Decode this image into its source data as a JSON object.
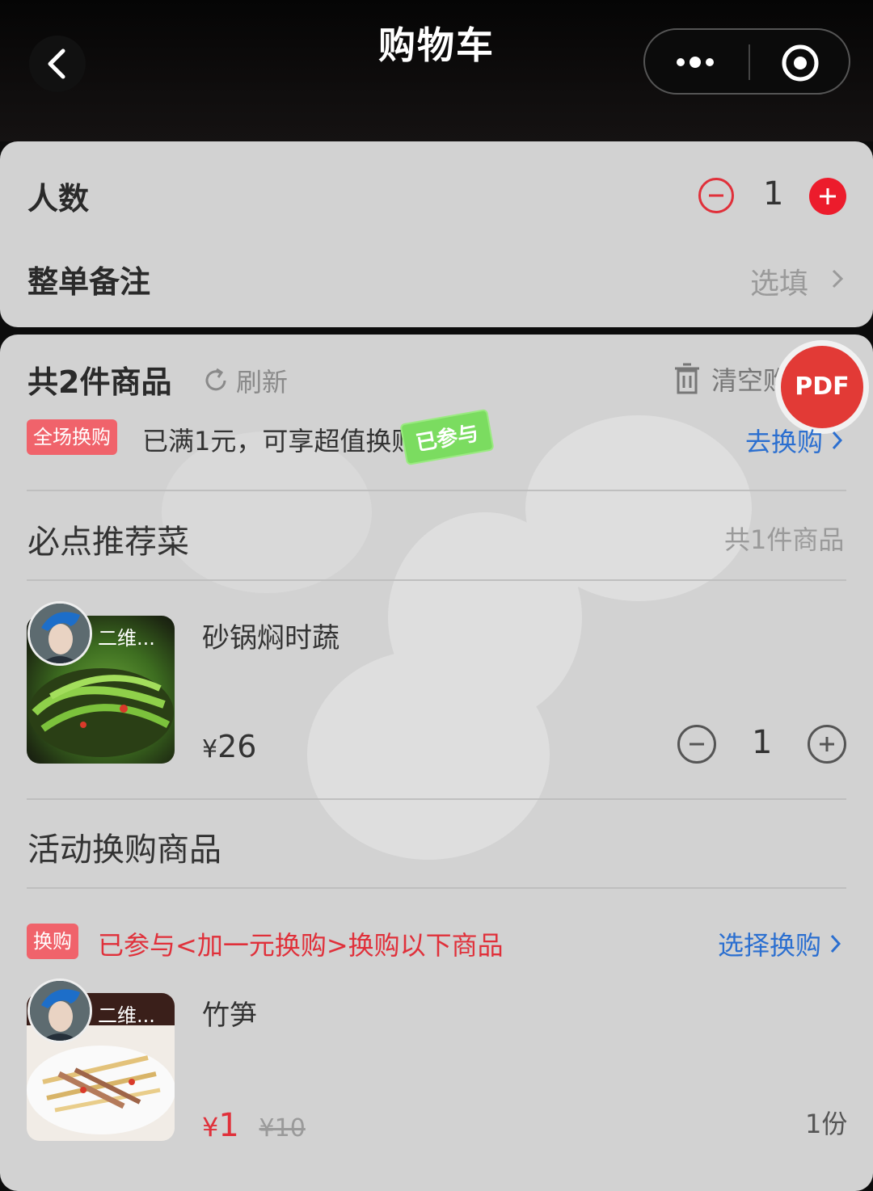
{
  "nav": {
    "title": "购物车"
  },
  "people": {
    "label": "人数",
    "count": "1"
  },
  "remark": {
    "label": "整单备注",
    "placeholder": "选填"
  },
  "cart": {
    "total_label": "共2件商品",
    "refresh_label": "刷新",
    "clear_label": "清空购",
    "pdf_label": "PDF",
    "promo": {
      "tag": "全场换购",
      "text": "已满1元，可享超值换购",
      "stamp": "已参与",
      "link": "去换购"
    }
  },
  "section_recommended": {
    "title": "必点推荐菜",
    "count_label": "共1件商品",
    "items": [
      {
        "avatar_caption": "二维...",
        "name": "砂锅焖时蔬",
        "currency": "¥",
        "price": "26",
        "quantity": "1"
      }
    ]
  },
  "section_exchange": {
    "title": "活动换购商品",
    "tag": "换购",
    "notice": "已参与<加一元换购>换购以下商品",
    "link": "选择换购",
    "items": [
      {
        "avatar_caption": "二维...",
        "name": "竹笋",
        "currency": "¥",
        "price": "1",
        "original_price": "¥10",
        "quantity_label": "1份"
      }
    ]
  },
  "colors": {
    "accent_red": "#ec1c2c",
    "link_blue": "#2b6fd0",
    "promo_tag": "#f0636b",
    "joined_stamp": "#7bdc60"
  },
  "icons": [
    "back-arrow-icon",
    "more-dots-icon",
    "close-target-icon",
    "minus-icon",
    "plus-icon",
    "chevron-right-icon",
    "refresh-icon",
    "trash-icon"
  ]
}
